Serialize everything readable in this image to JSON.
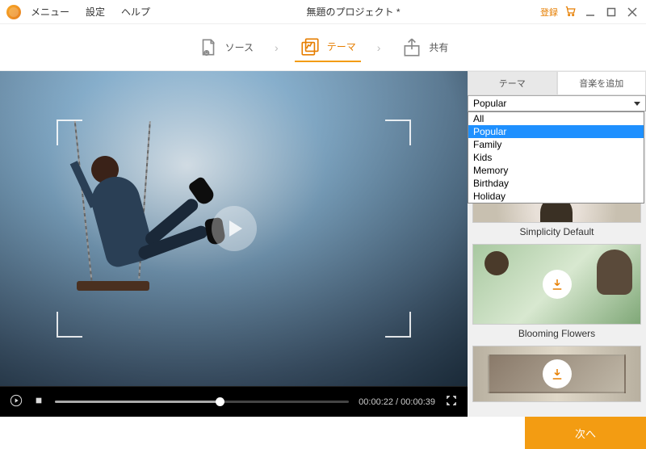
{
  "titlebar": {
    "menu": "メニュー",
    "settings": "設定",
    "help": "ヘルプ",
    "title": "無題のプロジェクト *",
    "login": "登録"
  },
  "steps": {
    "source": "ソース",
    "theme": "テーマ",
    "share": "共有"
  },
  "player": {
    "current_time": "00:00:22",
    "total_time": "00:00:39",
    "progress_pct": 56
  },
  "sidebar": {
    "tab_theme": "テーマ",
    "tab_music": "音楽を追加",
    "category_selected": "Popular",
    "categories": [
      "All",
      "Popular",
      "Family",
      "Kids",
      "Memory",
      "Birthday",
      "Holiday"
    ],
    "themes": [
      {
        "name": "Simplicity Default",
        "downloadable": false
      },
      {
        "name": "Blooming Flowers",
        "downloadable": true
      },
      {
        "name": "",
        "downloadable": true
      }
    ]
  },
  "footer": {
    "next": "次へ"
  }
}
